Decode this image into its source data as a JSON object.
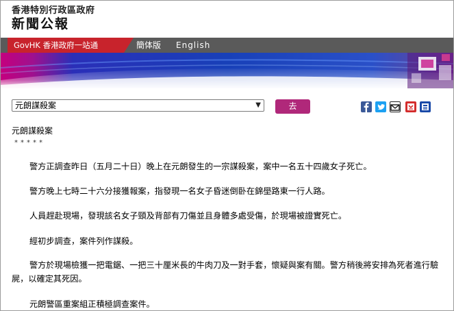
{
  "header": {
    "gov_title": "香港特別行政區政府",
    "press_title": "新聞公報"
  },
  "nav": {
    "govhk": "GovHK 香港政府一站通",
    "simplified": "簡体版",
    "english": "English"
  },
  "toolbar": {
    "select_value": "元朗謀殺案",
    "go_label": "去",
    "share_icons": [
      "facebook-icon",
      "twitter-icon",
      "email-icon",
      "bookmark-icon",
      "print-icon"
    ]
  },
  "article": {
    "title": "元朗謀殺案",
    "stars": "*****",
    "paragraphs": [
      "警方正調查昨日（五月二十日）晚上在元朗發生的一宗謀殺案，案中一名五十四歲女子死亡。",
      "警方晚上七時二十六分接獲報案，指發現一名女子昏迷倒卧在錦壆路東一行人路。",
      "人員趕赴現場，發現該名女子頸及背部有刀傷並且身體多處受傷，於現場被證實死亡。",
      "經初步調查，案件列作謀殺。",
      "警方於現場檢獲一把電鋸、一把三十厘米長的牛肉刀及一對手套，懷疑與案有關。警方稍後將安排為死者進行驗屍，以確定其死因。",
      "元朗警區重案組正積極調查案件。"
    ]
  },
  "colors": {
    "govhk_red": "#c8232c",
    "nav_gray": "#5a5a5a",
    "go_button": "#b0287a",
    "banner_blue": "#1a3fb0",
    "banner_magenta": "#c4007e"
  }
}
